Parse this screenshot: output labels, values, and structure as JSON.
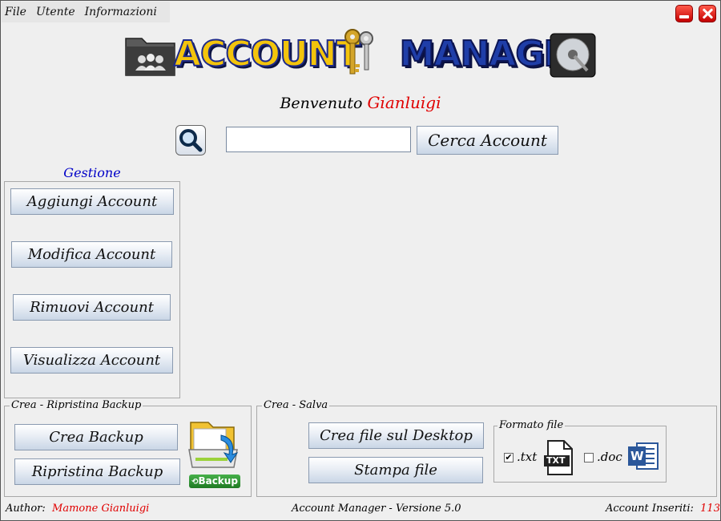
{
  "menu": {
    "file": "File",
    "utente": "Utente",
    "informazioni": "Informazioni"
  },
  "logo": {
    "word1": "ACCOUNT",
    "word2": "MANAGER"
  },
  "welcome": {
    "prefix": "Benvenuto",
    "user": "Gianluigi"
  },
  "search": {
    "value": "",
    "placeholder": "",
    "button": "Cerca Account"
  },
  "gestione": {
    "title": "Gestione",
    "buttons": [
      "Aggiungi Account",
      "Modifica Account",
      "Rimuovi Account",
      "Visualizza Account"
    ]
  },
  "backup": {
    "title": "Crea - Ripristina Backup",
    "create": "Crea Backup",
    "restore": "Ripristina Backup",
    "icon_label": "Backup"
  },
  "save": {
    "title": "Crea - Salva",
    "desktop": "Crea file sul Desktop",
    "print": "Stampa file",
    "format": {
      "title": "Formato file",
      "txt": ".txt",
      "txt_checked": true,
      "doc": ".doc",
      "doc_checked": false,
      "txt_icon_text": "TXT",
      "word_icon_text": "W"
    }
  },
  "footer": {
    "author_label": "Author:",
    "author": "Mamone Gianluigi",
    "version": "Account Manager - Versione 5.0",
    "count_label": "Account Inseriti:",
    "count": "113"
  },
  "colors": {
    "accent_red": "#e00000",
    "accent_blue": "#0000c8",
    "logo_yellow": "#f3c40c",
    "logo_blue": "#1f3ea8"
  }
}
